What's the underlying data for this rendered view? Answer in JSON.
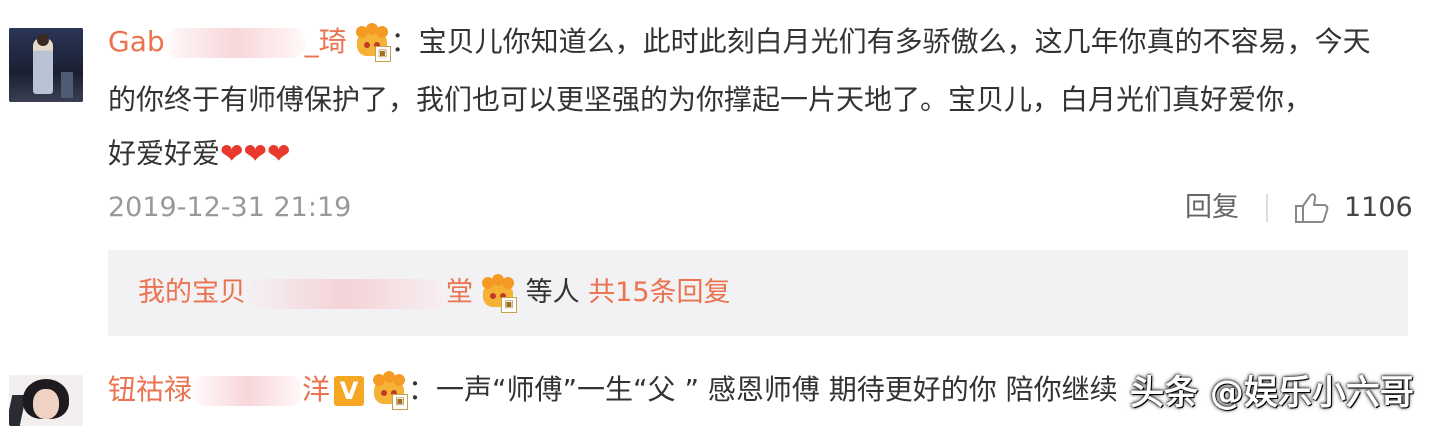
{
  "comment1": {
    "author_prefix": "Gab",
    "author_suffix": "_琦",
    "text_line1": "：宝贝儿你知道么，此时此刻白月光们有多骄傲么，这几年你真的不容易，今天",
    "text_line2": "的你终于有师傅保护了，我们也可以更坚强的为你撑起一片天地了。宝贝儿，白月光们真好爱你，",
    "text_line3": "好爱好爱",
    "hearts": "❤❤❤",
    "timestamp": "2019-12-31 21:19",
    "reply_label": "回复",
    "like_count": "1106"
  },
  "replies_summary": {
    "user_prefix": "我的宝贝",
    "user_suffix": "堂",
    "others": "等人",
    "count_link": "共15条回复"
  },
  "comment2": {
    "author_prefix": "钮祜禄",
    "author_suffix": "洋",
    "vip_badge": "V",
    "text": "：一声“师傅”一生“父 ” 感恩师傅  期待更好的你 陪你继续"
  },
  "watermark": "头条 @娱乐小六哥",
  "icons": {
    "crown": "crown-badge-icon",
    "like": "thumbs-up-icon",
    "vip": "vip-v-icon"
  },
  "colors": {
    "accent": "#eb7350",
    "muted": "#999999",
    "reply_bg": "#f2f2f5"
  }
}
